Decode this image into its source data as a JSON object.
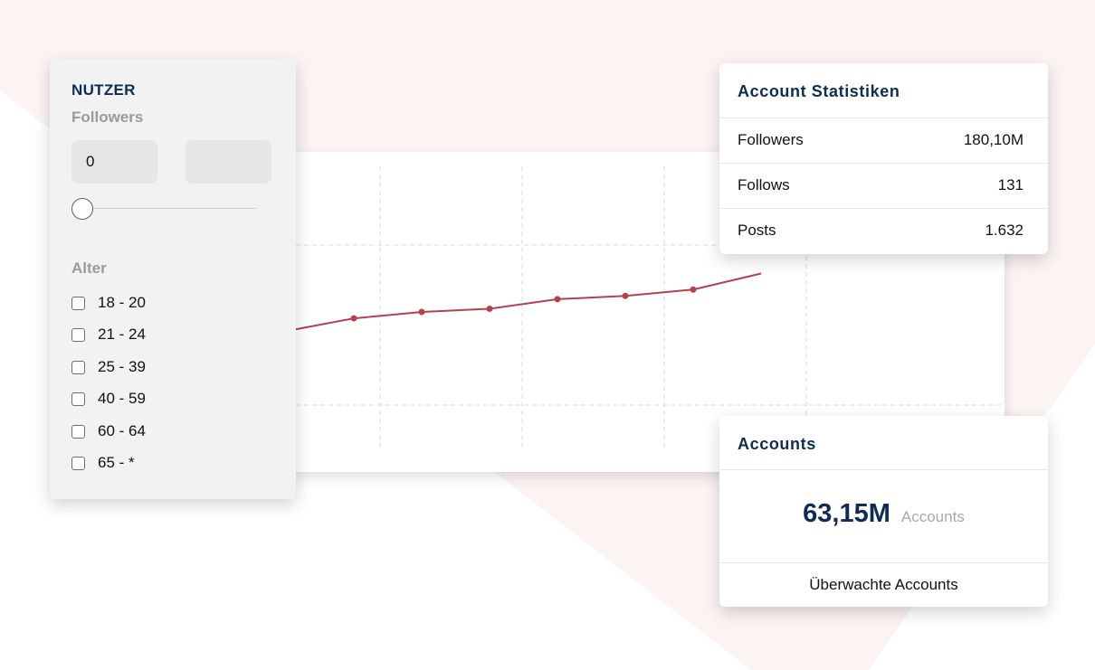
{
  "filter": {
    "title": "NUTZER",
    "followers_label": "Followers",
    "followers_min": "0",
    "followers_max": "",
    "slider_value": 0,
    "age_label": "Alter",
    "age_groups": [
      "18 - 20",
      "21 - 24",
      "25 - 39",
      "40 - 59",
      "60 - 64",
      "65 - *"
    ]
  },
  "stats": {
    "title": "Account Statistiken",
    "rows": [
      {
        "label": "Followers",
        "value": "180,10M"
      },
      {
        "label": "Follows",
        "value": "131"
      },
      {
        "label": "Posts",
        "value": "1.632"
      }
    ]
  },
  "accounts": {
    "title": "Accounts",
    "value": "63,15M",
    "unit": "Accounts",
    "footer": "Überwachte Accounts"
  },
  "colors": {
    "accent_navy": "#0f2c55",
    "line_red": "#b5414f",
    "background_shape": "#fcf3f3"
  },
  "chart_data": {
    "type": "line",
    "title": "",
    "xlabel": "",
    "ylabel": "",
    "grid": true,
    "x": [
      0,
      1,
      2,
      3,
      4,
      5,
      6,
      7
    ],
    "ylim": [
      0,
      10
    ],
    "series": [
      {
        "values": [
          4.4,
          4.8,
          5.0,
          5.1,
          5.4,
          5.5,
          5.7,
          6.2
        ]
      }
    ]
  }
}
